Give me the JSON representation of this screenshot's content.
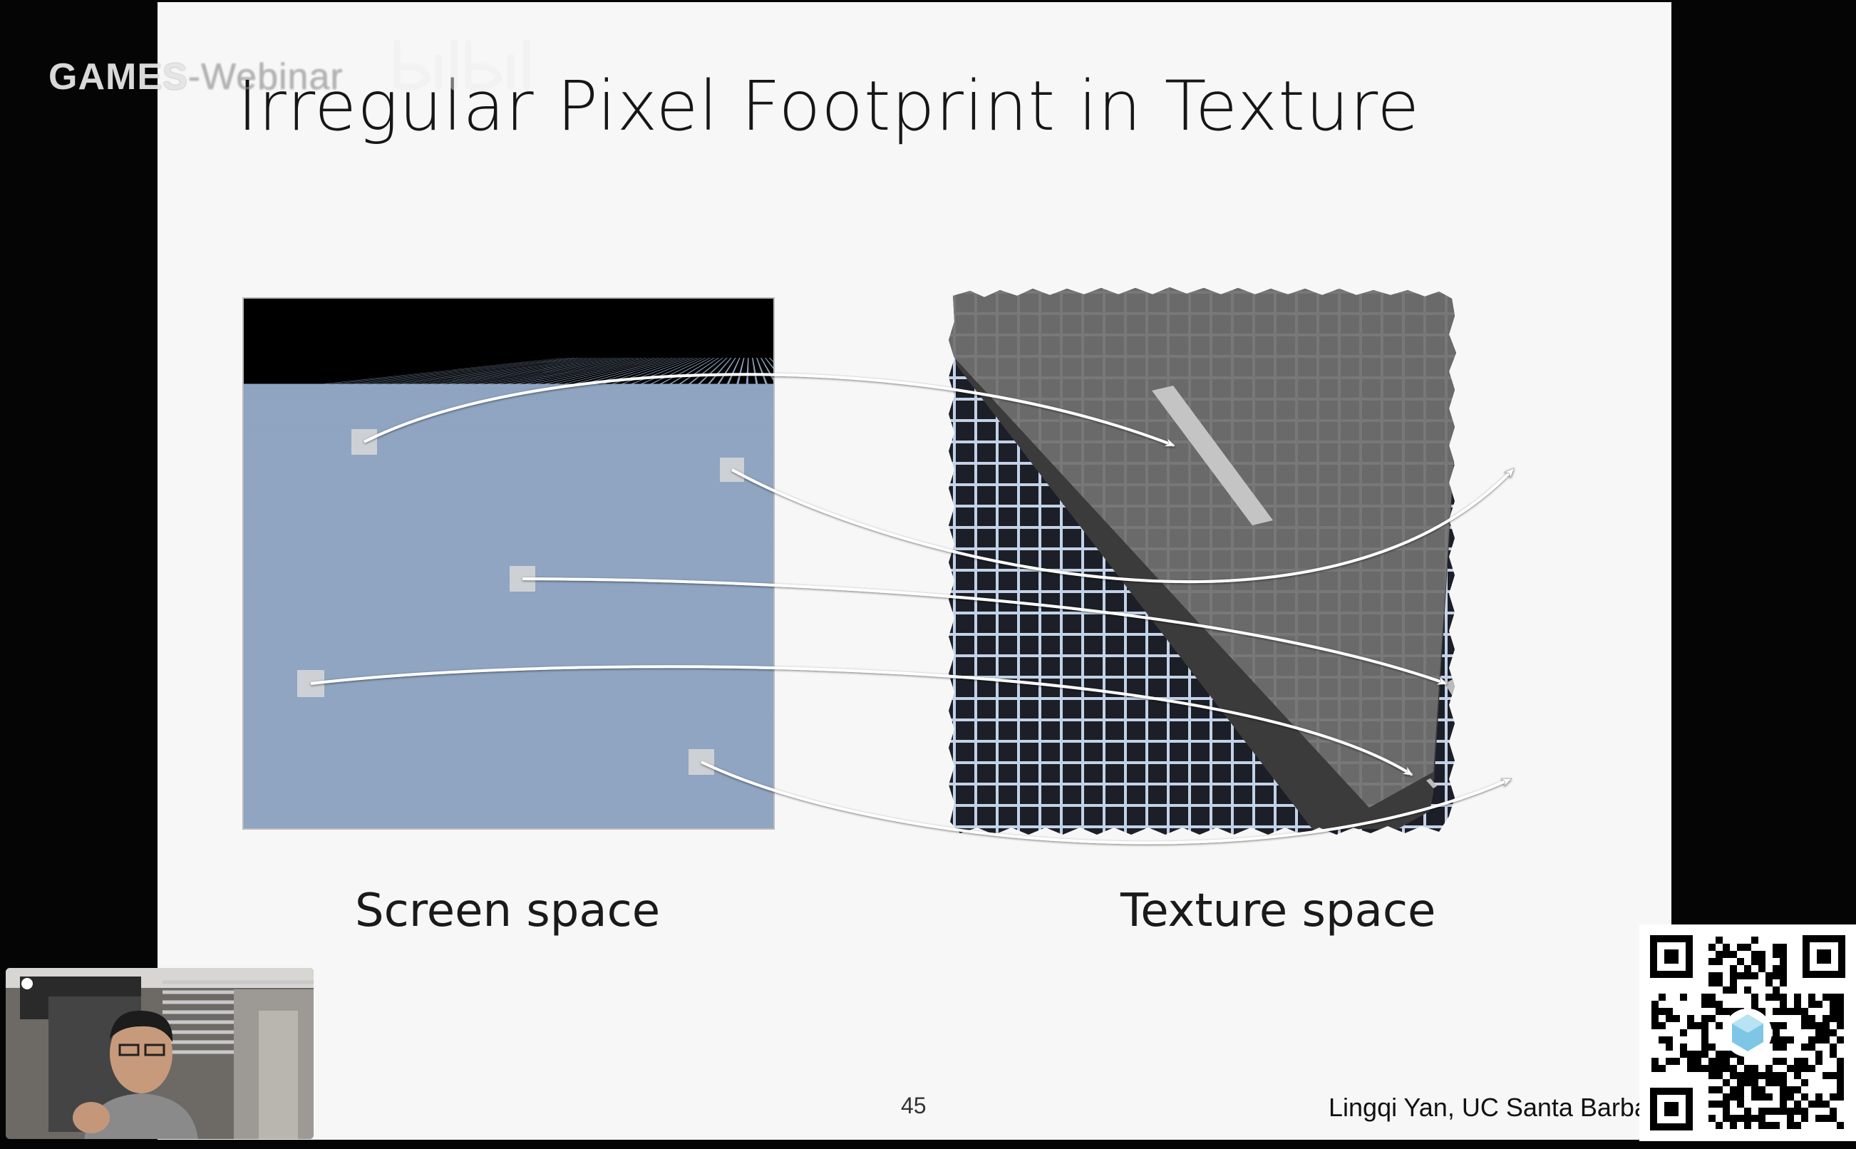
{
  "slide": {
    "title": "Irregular Pixel Footprint in Texture",
    "caption_left": "Screen space",
    "caption_right": "Texture space",
    "page_number": "45",
    "credit": "Lingqi Yan, UC Santa Barbara"
  },
  "overlay": {
    "watermark_bold": "GAMES",
    "watermark_faded": "-Webinar",
    "logo_name": "bilibili-logo-icon"
  },
  "colors": {
    "slide_bg": "#f7f7f7",
    "screen_grid": "#8fa5c1",
    "texture_grid": "#c4d2e8",
    "texture_dark": "#1c1f27",
    "parallelogram": "#6b6b6b",
    "arrow": "#ffffff"
  },
  "icons": [
    "mouse-cursor-icon",
    "qr-code-icon",
    "bilibili-logo-icon"
  ]
}
